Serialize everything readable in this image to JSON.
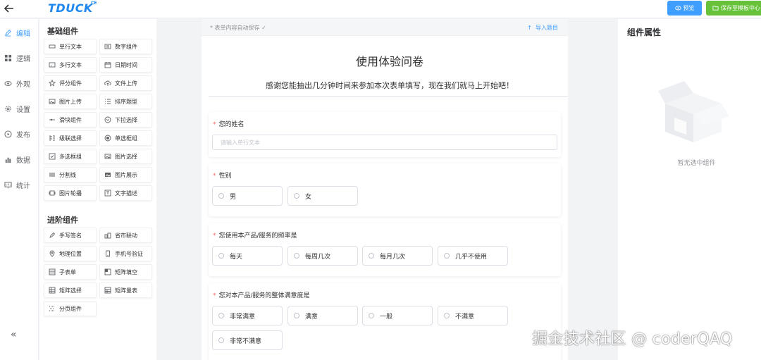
{
  "topbar": {
    "logo": "TDUCK",
    "logo_suffix": "CE",
    "preview_label": "预览",
    "save_label": "保存至模板中心",
    "accent": "#409eff",
    "save_color": "#67c23a"
  },
  "leftnav": {
    "items": [
      {
        "label": "编辑",
        "icon": "edit-icon",
        "active": true
      },
      {
        "label": "逻辑",
        "icon": "grid-icon",
        "active": false
      },
      {
        "label": "外观",
        "icon": "eye-icon",
        "active": false
      },
      {
        "label": "设置",
        "icon": "gear-icon",
        "active": false
      },
      {
        "label": "发布",
        "icon": "play-icon",
        "active": false
      },
      {
        "label": "数据",
        "icon": "bar-chart-icon",
        "active": false
      },
      {
        "label": "统计",
        "icon": "stats-icon",
        "active": false
      }
    ],
    "collapse_icon": "«"
  },
  "components": {
    "basic_title": "基础组件",
    "basic": [
      {
        "label": "单行文本",
        "icon": "input-icon"
      },
      {
        "label": "数字组件",
        "icon": "number-icon"
      },
      {
        "label": "多行文本",
        "icon": "textarea-icon"
      },
      {
        "label": "日期时间",
        "icon": "calendar-icon"
      },
      {
        "label": "评分组件",
        "icon": "star-icon"
      },
      {
        "label": "文件上传",
        "icon": "upload-cloud-icon"
      },
      {
        "label": "图片上传",
        "icon": "image-upload-icon"
      },
      {
        "label": "排序题型",
        "icon": "sort-icon"
      },
      {
        "label": "滑块组件",
        "icon": "slider-icon"
      },
      {
        "label": "下拉选择",
        "icon": "dropdown-icon"
      },
      {
        "label": "级联选择",
        "icon": "cascade-icon"
      },
      {
        "label": "单选框组",
        "icon": "radio-icon"
      },
      {
        "label": "多选框组",
        "icon": "checkbox-icon"
      },
      {
        "label": "图片选择",
        "icon": "image-select-icon"
      },
      {
        "label": "分割线",
        "icon": "divider-icon"
      },
      {
        "label": "图片展示",
        "icon": "image-icon"
      },
      {
        "label": "图片轮播",
        "icon": "carousel-icon"
      },
      {
        "label": "文字描述",
        "icon": "text-icon"
      }
    ],
    "advanced_title": "进阶组件",
    "advanced": [
      {
        "label": "手写签名",
        "icon": "pen-icon"
      },
      {
        "label": "省市联动",
        "icon": "region-icon"
      },
      {
        "label": "地理位置",
        "icon": "location-icon"
      },
      {
        "label": "手机号验证",
        "icon": "phone-icon"
      },
      {
        "label": "子表单",
        "icon": "subform-icon"
      },
      {
        "label": "矩阵填空",
        "icon": "matrix-fill-icon"
      },
      {
        "label": "矩阵选择",
        "icon": "matrix-select-icon"
      },
      {
        "label": "矩阵量表",
        "icon": "matrix-scale-icon"
      },
      {
        "label": "分页组件",
        "icon": "pagination-icon"
      }
    ]
  },
  "canvas": {
    "autosave": "* 表单内容自动保存 ✓",
    "import_label": "导入题目",
    "title": "使用体验问卷",
    "description": "感谢您能抽出几分钟时间来参加本次表单填写，现在我们就马上开始吧！",
    "questions": [
      {
        "title": "您的姓名",
        "type": "input",
        "placeholder": "请输入单行文本"
      },
      {
        "title": "性别",
        "type": "radio",
        "options": [
          "男",
          "女"
        ]
      },
      {
        "title": "您使用本产品/服务的频率是",
        "type": "radio",
        "options": [
          "每天",
          "每周几次",
          "每月几次",
          "几乎不使用"
        ]
      },
      {
        "title": "您对本产品/服务的整体满意度是",
        "type": "radio",
        "options": [
          "非常满意",
          "满意",
          "一般",
          "不满意",
          "非常不满意"
        ]
      }
    ]
  },
  "right_panel": {
    "title": "组件属性",
    "empty_text": "暂无选中组件"
  },
  "watermark": "掘金技术社区 @ coderQAQ"
}
